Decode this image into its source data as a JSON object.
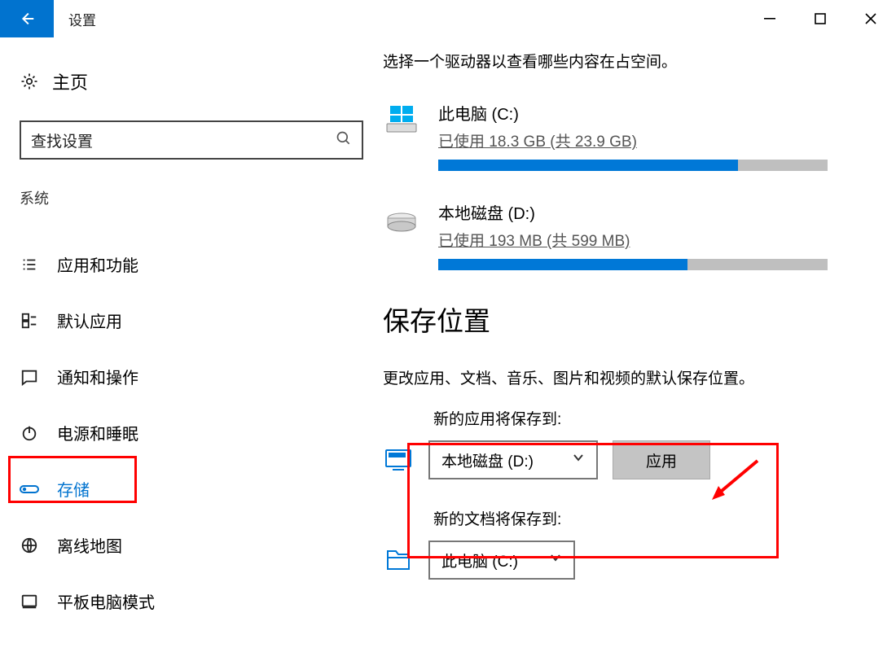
{
  "titlebar": {
    "title": "设置"
  },
  "sidebar": {
    "home": "主页",
    "search_placeholder": "查找设置",
    "group": "系统",
    "items": [
      {
        "label": "应用和功能"
      },
      {
        "label": "默认应用"
      },
      {
        "label": "通知和操作"
      },
      {
        "label": "电源和睡眠"
      },
      {
        "label": "存储",
        "selected": true
      },
      {
        "label": "离线地图"
      },
      {
        "label": "平板电脑模式"
      }
    ]
  },
  "main": {
    "description": "选择一个驱动器以查看哪些内容在占空间。",
    "drives": [
      {
        "name": "此电脑 (C:)",
        "usage": "已使用 18.3 GB (共 23.9 GB)",
        "fill_pct": 77
      },
      {
        "name": "本地磁盘 (D:)",
        "usage": "已使用 193 MB (共 599 MB)",
        "fill_pct": 64
      }
    ],
    "section_heading": "保存位置",
    "section_desc": "更改应用、文档、音乐、图片和视频的默认保存位置。",
    "save_locations": [
      {
        "caption": "新的应用将保存到:",
        "value": "本地磁盘 (D:)",
        "show_apply": true,
        "apply_label": "应用"
      },
      {
        "caption": "新的文档将保存到:",
        "value": "此电脑 (C:)",
        "show_apply": false
      }
    ]
  }
}
